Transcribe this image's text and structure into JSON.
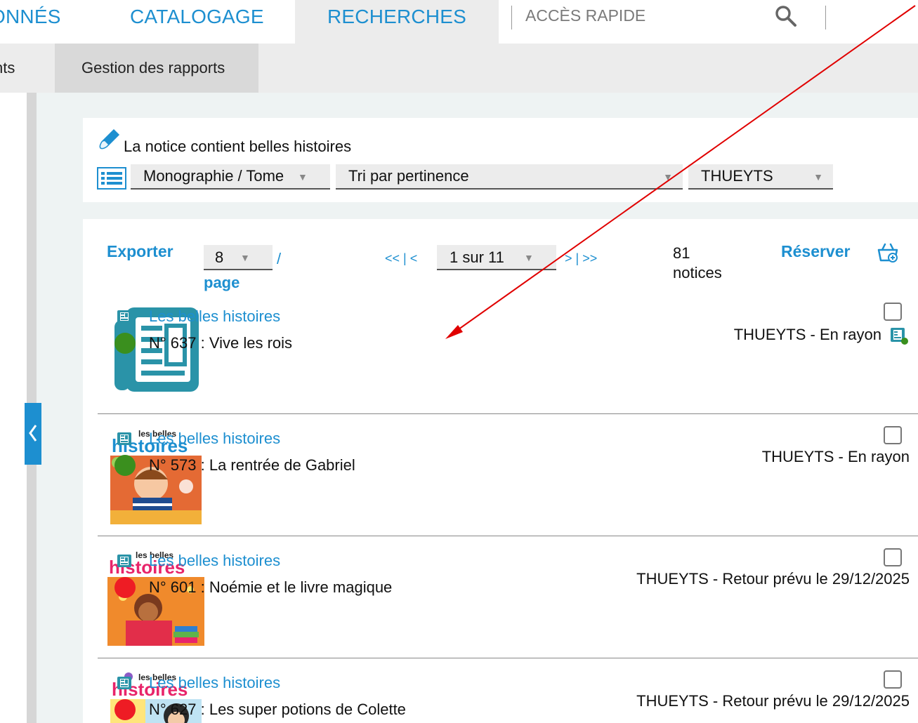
{
  "topnav": {
    "tab_donnes": "ONNÉS",
    "tab_catalogage": "CATALOGAGE",
    "tab_recherches": "RECHERCHES",
    "acces_rapide": "ACCÈS RAPIDE"
  },
  "subnav": {
    "left_item": "nts",
    "active_item": "Gestion des rapports"
  },
  "query": {
    "text": "La notice contient belles histoires",
    "type_select": "Monographie / Tome",
    "sort_select": "Tri par pertinence",
    "library_select": "THUEYTS"
  },
  "toolbar": {
    "export_label": "Exporter",
    "per_page_value": "8",
    "slash": "/",
    "page_word": "page",
    "first_prev": "<< | <",
    "page_select": "1 sur 11",
    "next_last": "> | >>",
    "count_number": "81",
    "count_word": "notices",
    "reserve_label": "Réserver"
  },
  "results": [
    {
      "series": "Les belles histoires",
      "issue": "N° 637 : Vive les rois",
      "availability": "THUEYTS - En rayon",
      "status_color": "#3a8f1e"
    },
    {
      "series": "Les belles histoires",
      "issue": "N° 573 : La rentrée de Gabriel",
      "availability": "THUEYTS - En rayon",
      "status_color": "#3a8f1e"
    },
    {
      "series": "Les belles histoires",
      "issue": "N° 601 : Noémie et le livre magique",
      "availability": "THUEYTS - Retour prévu le 29/12/2025",
      "status_color": "#ee1c24"
    },
    {
      "series": "Les belles histoires",
      "issue": "N° 627 : Les super potions de Colette",
      "availability": "THUEYTS - Retour prévu le 29/12/2025",
      "status_color": "#ee1c24"
    }
  ],
  "thumbnails": {
    "cover_brand_small": "les belles",
    "cover_brand_big": "histoires"
  },
  "colors": {
    "accent": "#1d8fd0",
    "available": "#3a8f1e",
    "unavailable": "#ee1c24",
    "annotation": "#e00000"
  }
}
